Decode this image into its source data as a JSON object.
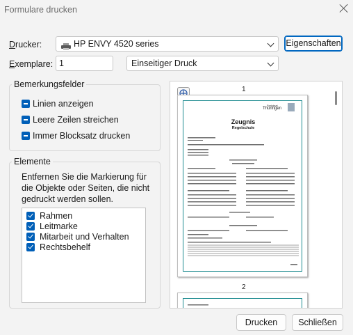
{
  "window": {
    "title": "Formulare drucken"
  },
  "printer": {
    "label_pre": "",
    "label_u": "D",
    "label_post": "rucker:",
    "selected": "HP ENVY 4520 series",
    "properties_button": "Eigenschaften"
  },
  "copies": {
    "label_u": "E",
    "label_post": "xemplare:",
    "value": "1",
    "duplex_selected": "Einseitiger Druck"
  },
  "remarks": {
    "title": "Bemerkungsfelder",
    "options": [
      "Linien anzeigen",
      "Leere Zeilen streichen",
      "Immer Blocksatz drucken"
    ]
  },
  "elements": {
    "title": "Elemente",
    "description": "Entfernen Sie die Markierung für die Objekte oder Seiten, die nicht gedruckt werden sollen.",
    "items": [
      "Rahmen",
      "Leitmarke",
      "Mitarbeit und Verhalten",
      "Rechtsbehelf"
    ]
  },
  "preview": {
    "page1_number": "1",
    "page2_number": "2",
    "doc": {
      "logo_text": "Freistaat",
      "logo_name": "Thüringen",
      "heading": "Zeugnis",
      "subheading": "Regelschule"
    }
  },
  "footer": {
    "print_button": "Drucken",
    "close_button": "Schließen"
  },
  "colors": {
    "accent": "#005fb8",
    "page_frame": "#1b8a8f"
  }
}
